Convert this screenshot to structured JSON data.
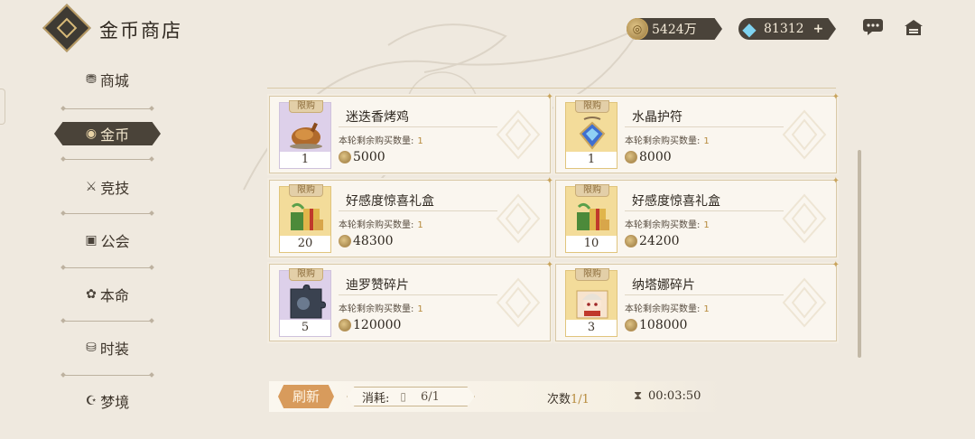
{
  "header": {
    "title": "金币商店",
    "gold_amount": "5424万",
    "gem_amount": "81312",
    "plus_label": "+"
  },
  "sidebar": {
    "items": [
      {
        "label": "商城",
        "icon": "⛃",
        "name": "shop"
      },
      {
        "label": "金币",
        "icon": "◉",
        "name": "gold"
      },
      {
        "label": "竞技",
        "icon": "⚔",
        "name": "arena"
      },
      {
        "label": "公会",
        "icon": "▣",
        "name": "guild"
      },
      {
        "label": "本命",
        "icon": "✿",
        "name": "destiny"
      },
      {
        "label": "时装",
        "icon": "⛁",
        "name": "fashion"
      },
      {
        "label": "梦境",
        "icon": "☪",
        "name": "dream"
      }
    ],
    "active_index": 1
  },
  "shop": {
    "limit_tag": "限购",
    "remain_label": "本轮剩余购买数量:",
    "items": [
      {
        "name": "迷迭香烤鸡",
        "qty": "1",
        "remain": "1",
        "price": "5000"
      },
      {
        "name": "水晶护符",
        "qty": "1",
        "remain": "1",
        "price": "8000"
      },
      {
        "name": "好感度惊喜礼盒",
        "qty": "20",
        "remain": "1",
        "price": "48300"
      },
      {
        "name": "好感度惊喜礼盒",
        "qty": "10",
        "remain": "1",
        "price": "24200"
      },
      {
        "name": "迪罗赞碎片",
        "qty": "5",
        "remain": "1",
        "price": "120000"
      },
      {
        "name": "纳塔娜碎片",
        "qty": "3",
        "remain": "1",
        "price": "108000"
      }
    ]
  },
  "footer": {
    "refresh_label": "刷新",
    "cost_label": "消耗:",
    "cost_value": "6/1",
    "count_label": "次数",
    "count_value": "1/1",
    "timer": "00:03:50"
  }
}
